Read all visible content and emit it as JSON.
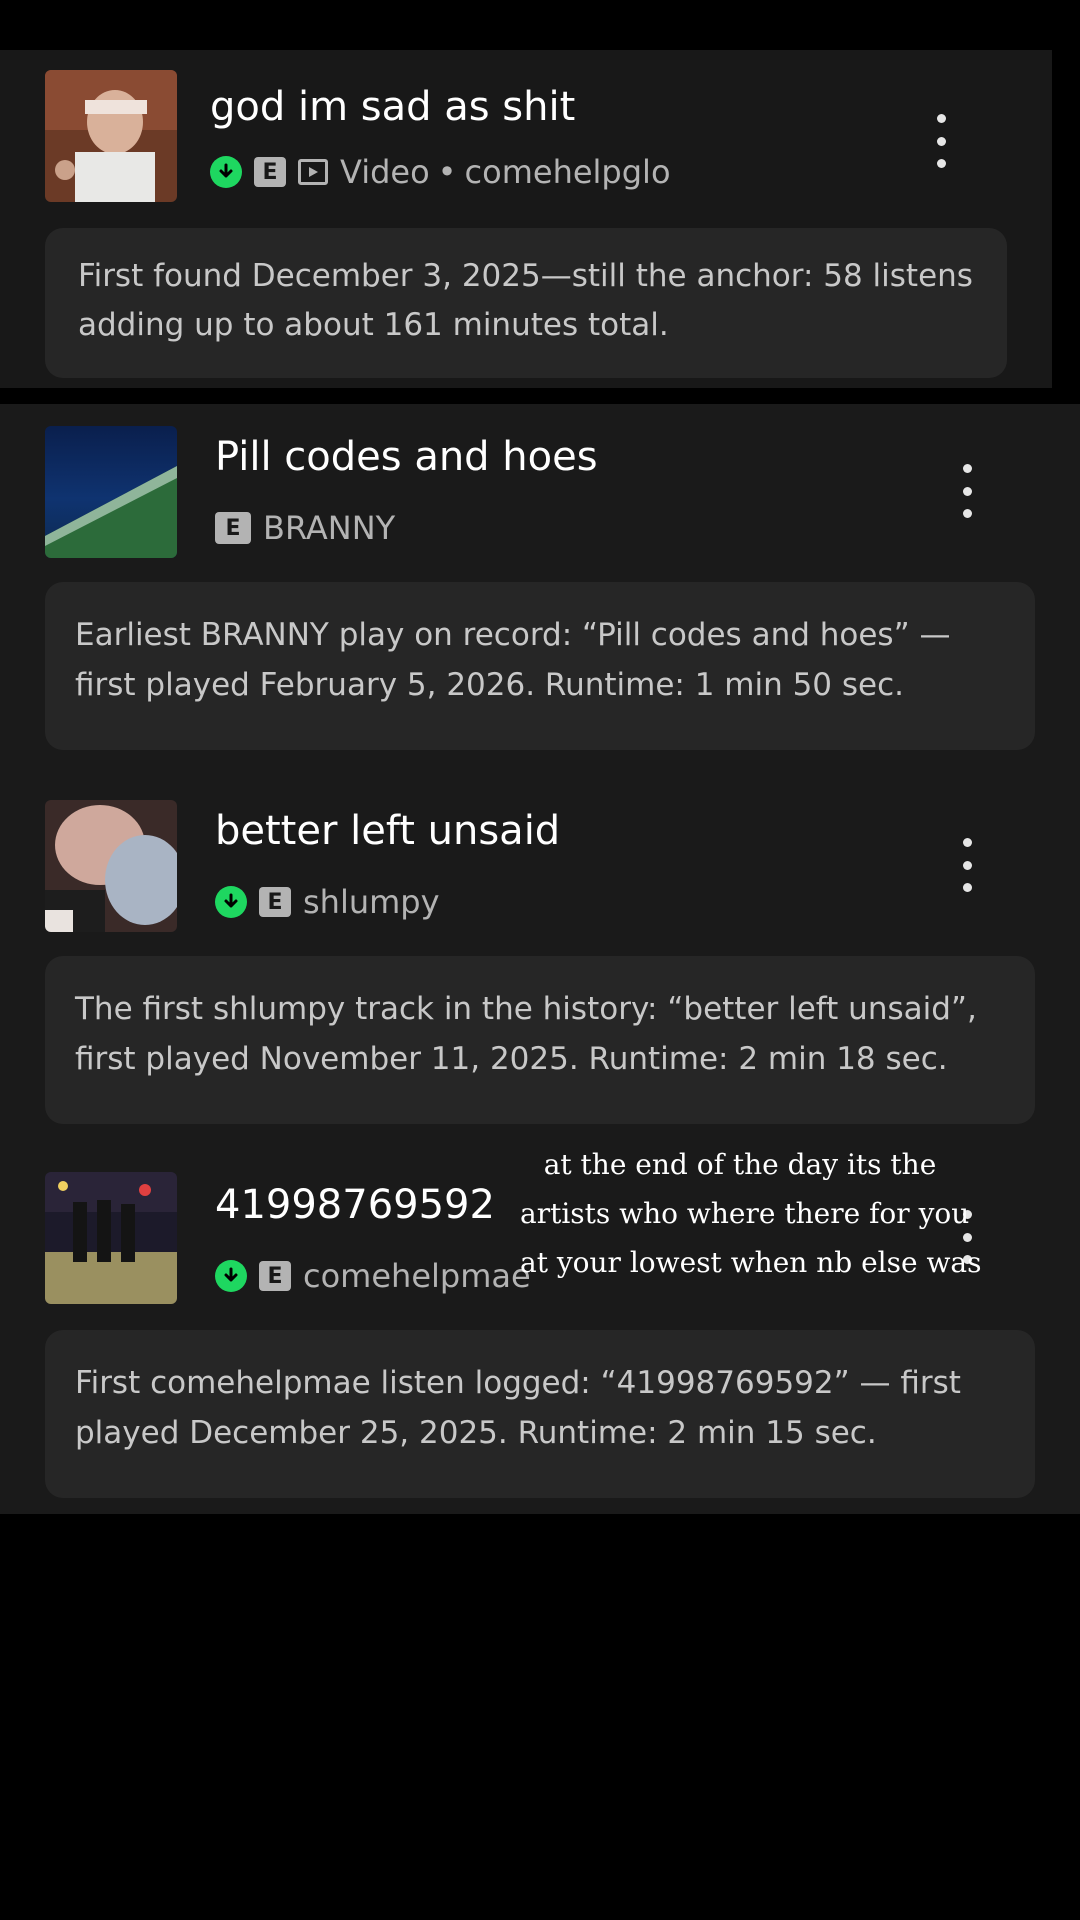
{
  "tracks": [
    {
      "title": "god im sad as shit",
      "downloaded": true,
      "explicit": "E",
      "type_label": "Video",
      "separator": "•",
      "artist": "comehelpglo",
      "note": "First found December 3, 2025—still the anchor: 58 listens adding up to about 161 minutes total."
    },
    {
      "title": "Pill codes and hoes",
      "downloaded": false,
      "explicit": "E",
      "artist": "BRANNY",
      "note": "Earliest BRANNY play on record: “Pill codes and hoes” — first played February 5, 2026. Runtime: 1 min 50 sec."
    },
    {
      "title": "better left unsaid",
      "downloaded": true,
      "explicit": "E",
      "artist": "shlumpy",
      "note": "The first shlumpy track in the history: “better left unsaid”, first played November 11, 2025. Runtime: 2 min 18 sec."
    },
    {
      "title": "41998769592",
      "downloaded": true,
      "explicit": "E",
      "artist": "comehelpmae",
      "note": "First comehelpmae listen logged: “41998769592” — first played December 25, 2025. Runtime: 2 min 15 sec."
    }
  ],
  "overlay_caption": {
    "line1": "at the end of the day its the",
    "line2": "artists who where there for you",
    "line3": "at your lowest when nb else was"
  },
  "colors": {
    "background": "#000000",
    "card": "#1a1a1a",
    "note_bg": "#262626",
    "download_green": "#1ed760",
    "secondary_text": "#b3b3b3"
  },
  "icons": {
    "download": "download-circle-icon",
    "explicit": "explicit-badge-icon",
    "video": "video-icon",
    "more": "more-vertical-icon"
  }
}
